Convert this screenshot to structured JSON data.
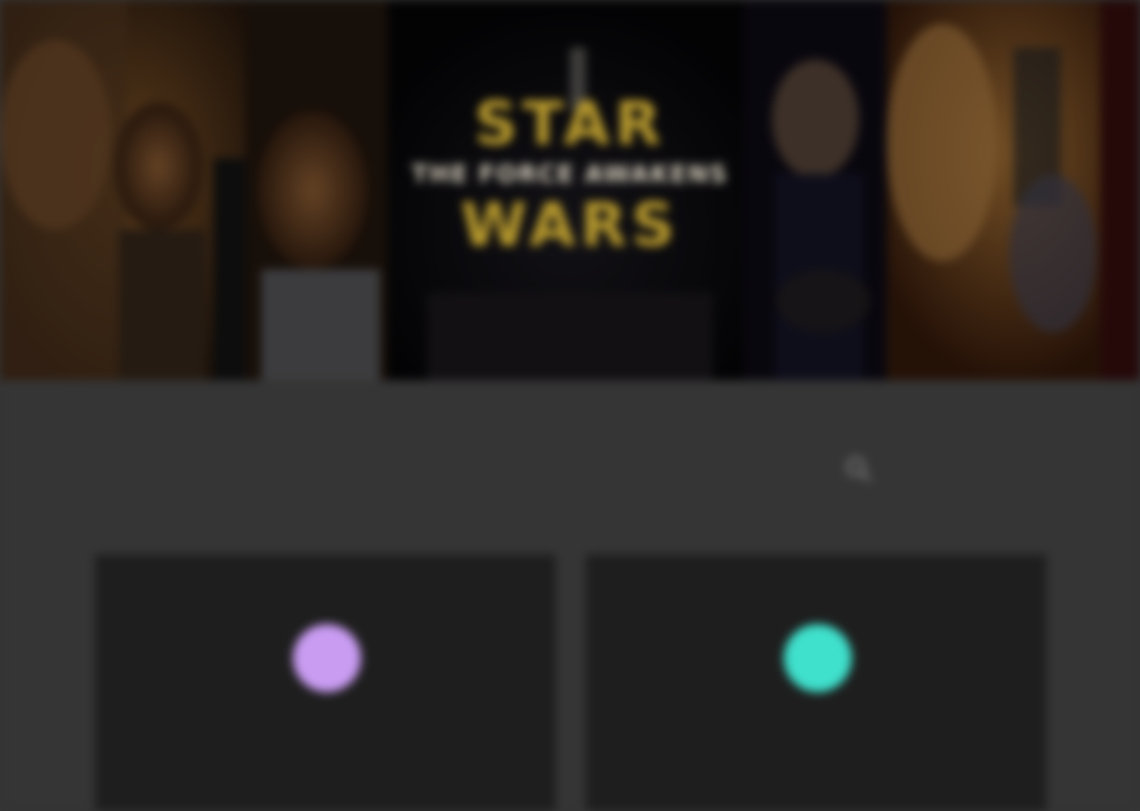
{
  "hero": {
    "title_top": "STAR",
    "title_middle": "THE FORCE AWAKENS",
    "title_bottom": "WARS",
    "title_color": "#b89a2e"
  },
  "toolbar": {
    "section_label": "",
    "search_icon": "search-icon"
  },
  "cards": [
    {
      "label": "",
      "accent_color": "#c99cf2"
    },
    {
      "label": "",
      "accent_color": "#3fe0cc"
    }
  ],
  "colors": {
    "page_background": "#353535",
    "card_background": "#1e1e1e",
    "hero_background": "#0e0b09"
  }
}
